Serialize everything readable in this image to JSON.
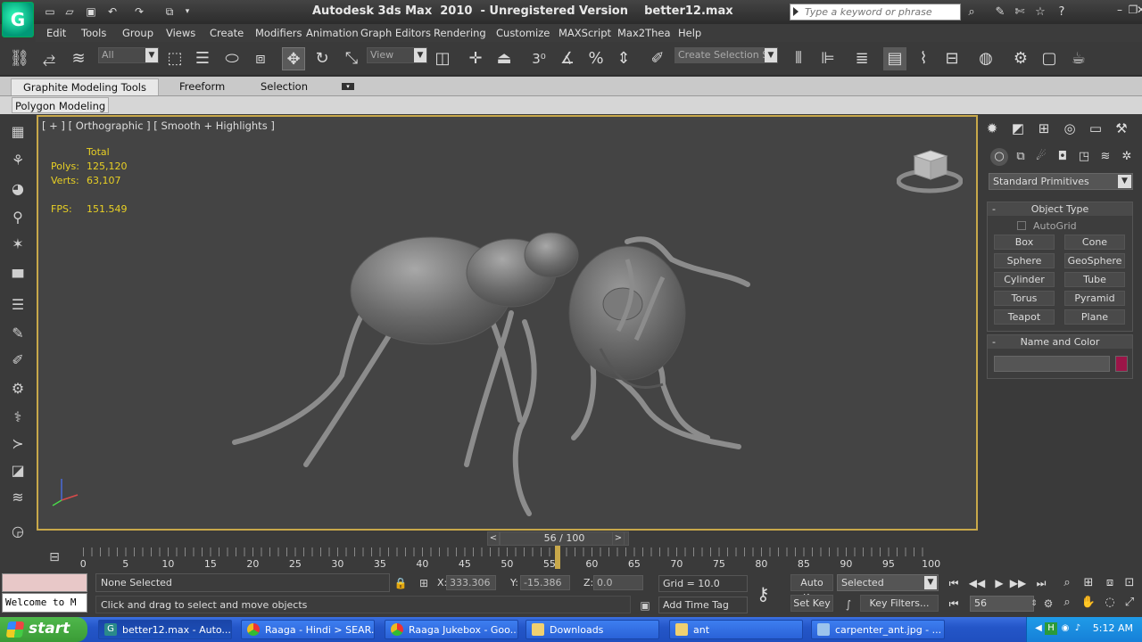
{
  "title_bar": {
    "title": "Autodesk 3ds Max  2010  - Unregistered Version    better12.max",
    "search_placeholder": "Type a keyword or phrase",
    "icons": [
      "binoculars-icon",
      "star-icon",
      "help-icon"
    ]
  },
  "menu": [
    "Edit",
    "Tools",
    "Group",
    "Views",
    "Create",
    "Modifiers",
    "Animation",
    "Graph Editors",
    "Rendering",
    "Customize",
    "MAXScript",
    "Max2Thea",
    "Help"
  ],
  "toolbar": {
    "selection_filter": "All",
    "reference_coord": "View",
    "named_selection_placeholder": "Create Selection Se"
  },
  "ribbon": {
    "tabs": [
      "Graphite Modeling Tools",
      "Freeform",
      "Selection"
    ],
    "active_tab": "Graphite Modeling Tools",
    "panel": "Polygon Modeling"
  },
  "viewport": {
    "label": "[ + ] [ Orthographic ] [ Smooth + Highlights ]",
    "stats": {
      "header": "Total",
      "polys_label": "Polys:",
      "polys": "125,120",
      "verts_label": "Verts:",
      "verts": "63,107",
      "fps_label": "FPS:",
      "fps": "151.549"
    }
  },
  "command_panel": {
    "category": "Standard Primitives",
    "object_type": {
      "title": "Object Type",
      "autogrid": "AutoGrid",
      "buttons": [
        "Box",
        "Cone",
        "Sphere",
        "GeoSphere",
        "Cylinder",
        "Tube",
        "Torus",
        "Pyramid",
        "Teapot",
        "Plane"
      ]
    },
    "name_color": {
      "title": "Name and Color",
      "color": "#9b1548"
    }
  },
  "time": {
    "slider": "56 / 100",
    "current_frame": 56,
    "total_frames": 100,
    "ticks": [
      "0",
      "5",
      "10",
      "15",
      "20",
      "25",
      "30",
      "35",
      "40",
      "45",
      "50",
      "55",
      "60",
      "65",
      "70",
      "75",
      "80",
      "85",
      "90",
      "95",
      "100"
    ]
  },
  "status": {
    "welcome": "Welcome to M",
    "selection": "None Selected",
    "prompt": "Click and drag to select and move objects",
    "x_label": "X:",
    "x": "333.306",
    "y_label": "Y:",
    "y": "-15.386",
    "z_label": "Z:",
    "z": "0.0",
    "grid": "Grid = 10.0",
    "add_time_tag": "Add Time Tag",
    "auto_key": "Auto Key",
    "set_key": "Set Key",
    "key_mode": "Selected",
    "key_filters": "Key Filters...",
    "frame": "56"
  },
  "taskbar": {
    "start": "start",
    "items": [
      {
        "label": "better12.max - Auto...",
        "icon": "3dsmax-icon"
      },
      {
        "label": "Raaga - Hindi > SEAR...",
        "icon": "chrome-icon"
      },
      {
        "label": "Raaga Jukebox - Goo...",
        "icon": "chrome-icon"
      },
      {
        "label": "Downloads",
        "icon": "folder-icon"
      },
      {
        "label": "ant",
        "icon": "folder-icon"
      },
      {
        "label": "carpenter_ant.jpg - ...",
        "icon": "image-viewer-icon"
      }
    ],
    "clock": "5:12 AM"
  }
}
